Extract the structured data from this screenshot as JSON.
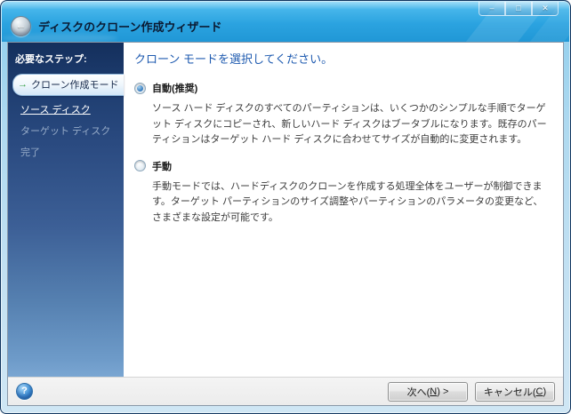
{
  "window": {
    "title": "ディスクのクローン作成ウィザード"
  },
  "icons": {
    "back": "←",
    "minimize": "–",
    "maximize": "□",
    "close": "✕",
    "help": "?",
    "active_step_arrow": "→"
  },
  "sidebar": {
    "header": "必要なステップ:",
    "items": [
      {
        "label": "クローン作成モード",
        "state": "active"
      },
      {
        "label": "ソース ディスク",
        "state": "link"
      },
      {
        "label": "ターゲット ディスク",
        "state": "disabled"
      },
      {
        "label": "完了",
        "state": "disabled"
      }
    ]
  },
  "main": {
    "heading": "クローン モードを選択してください。",
    "options": [
      {
        "label": "自動(推奨)",
        "selected": true,
        "description": "ソース ハード ディスクのすべてのパーティションは、いくつかのシンプルな手順でターゲット ディスクにコピーされ、新しいハード ディスクはブータブルになります。既存のパーティションはターゲット ハード ディスクに合わせてサイズが自動的に変更されます。"
      },
      {
        "label": "手動",
        "selected": false,
        "description": "手動モードでは、ハードディスクのクローンを作成する処理全体をユーザーが制御できます。ターゲット パーティションのサイズ調整やパーティションのパラメータの変更など、さまざまな設定が可能です。"
      }
    ]
  },
  "footer": {
    "next_button": {
      "pre": "次へ(",
      "key": "N",
      "post": ") >"
    },
    "cancel_button": {
      "pre": "キャンセル(",
      "key": "C",
      "post": ")"
    }
  },
  "colors": {
    "titlebar_blue": "#2BA3E0",
    "sidebar_top": "#142F5C",
    "sidebar_bottom": "#7AA6D2",
    "heading_blue": "#1F5BB0",
    "active_step_arrow_green": "#2F9E3F",
    "help_button_blue": "#2F79C2"
  }
}
